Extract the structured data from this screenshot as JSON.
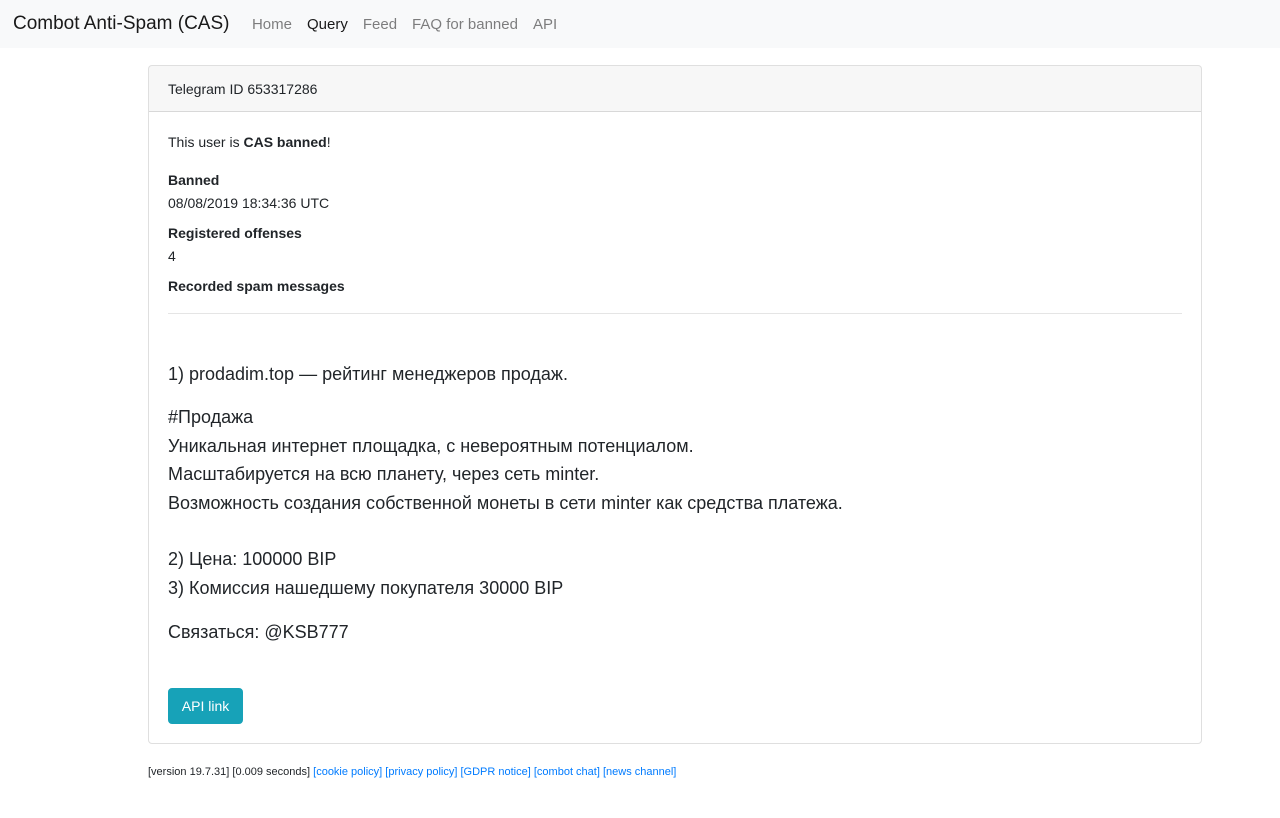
{
  "nav": {
    "brand": "Combot Anti-Spam (CAS)",
    "links": [
      "Home",
      "Query",
      "Feed",
      "FAQ for banned",
      "API"
    ],
    "active_index": 1
  },
  "card": {
    "header": "Telegram ID 653317286",
    "status_prefix": "This user is ",
    "status_bold": "CAS banned",
    "status_suffix": "!",
    "banned_label": "Banned",
    "banned_value": "08/08/2019 18:34:36 UTC",
    "offenses_label": "Registered offenses",
    "offenses_value": "4",
    "messages_label": "Recorded spam messages",
    "spam_lines": [
      "1) prodadim.top — рейтинг менеджеров продаж.",
      "#Продажа",
      "Уникальная интернет площадка, с невероятным потенциалом.",
      "Масштабируется на всю планету, через сеть minter.",
      "Возможность создания собственной монеты в сети minter как средства платежа.",
      "2) Цена: 100000 BIP",
      "3) Комиссия нашедшему покупателя 30000 BIP",
      "Связаться: @KSB777"
    ],
    "api_button": "API link"
  },
  "footer": {
    "version": "[version 19.7.31]",
    "timing": "[0.009 seconds]",
    "links": [
      "[cookie policy]",
      "[privacy policy]",
      "[GDPR notice]",
      "[combot chat]",
      "[news channel]"
    ]
  },
  "colors": {
    "accent": "#17a2b8",
    "link": "#007bff"
  }
}
